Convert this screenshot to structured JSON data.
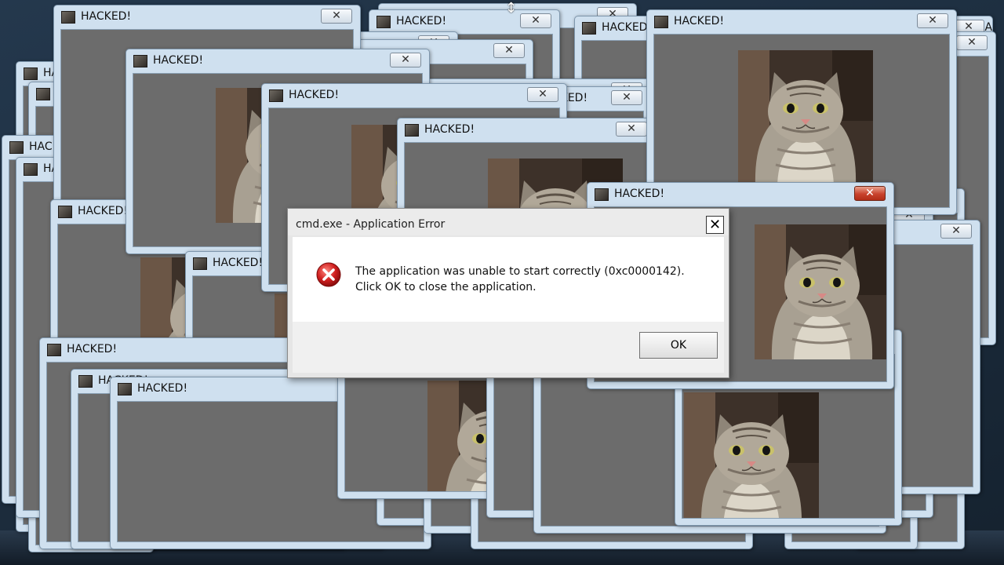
{
  "window_title": "HACKED!",
  "colors": {
    "titlebar": "#cfe0ef",
    "client_area": "#6c6c6c",
    "close_active": "#c8422c",
    "error_red": "#d01f1f"
  },
  "icons": {
    "window_icon": "cat-thumbnail-icon",
    "close": "close-icon",
    "error": "error-icon"
  },
  "close_glyph": "✕",
  "dialog": {
    "title": "cmd.exe - Application Error",
    "close_glyph": "✕",
    "message": "The application was unable to start correctly (0xc0000142). Click OK to close the application.",
    "ok_label": "OK"
  }
}
